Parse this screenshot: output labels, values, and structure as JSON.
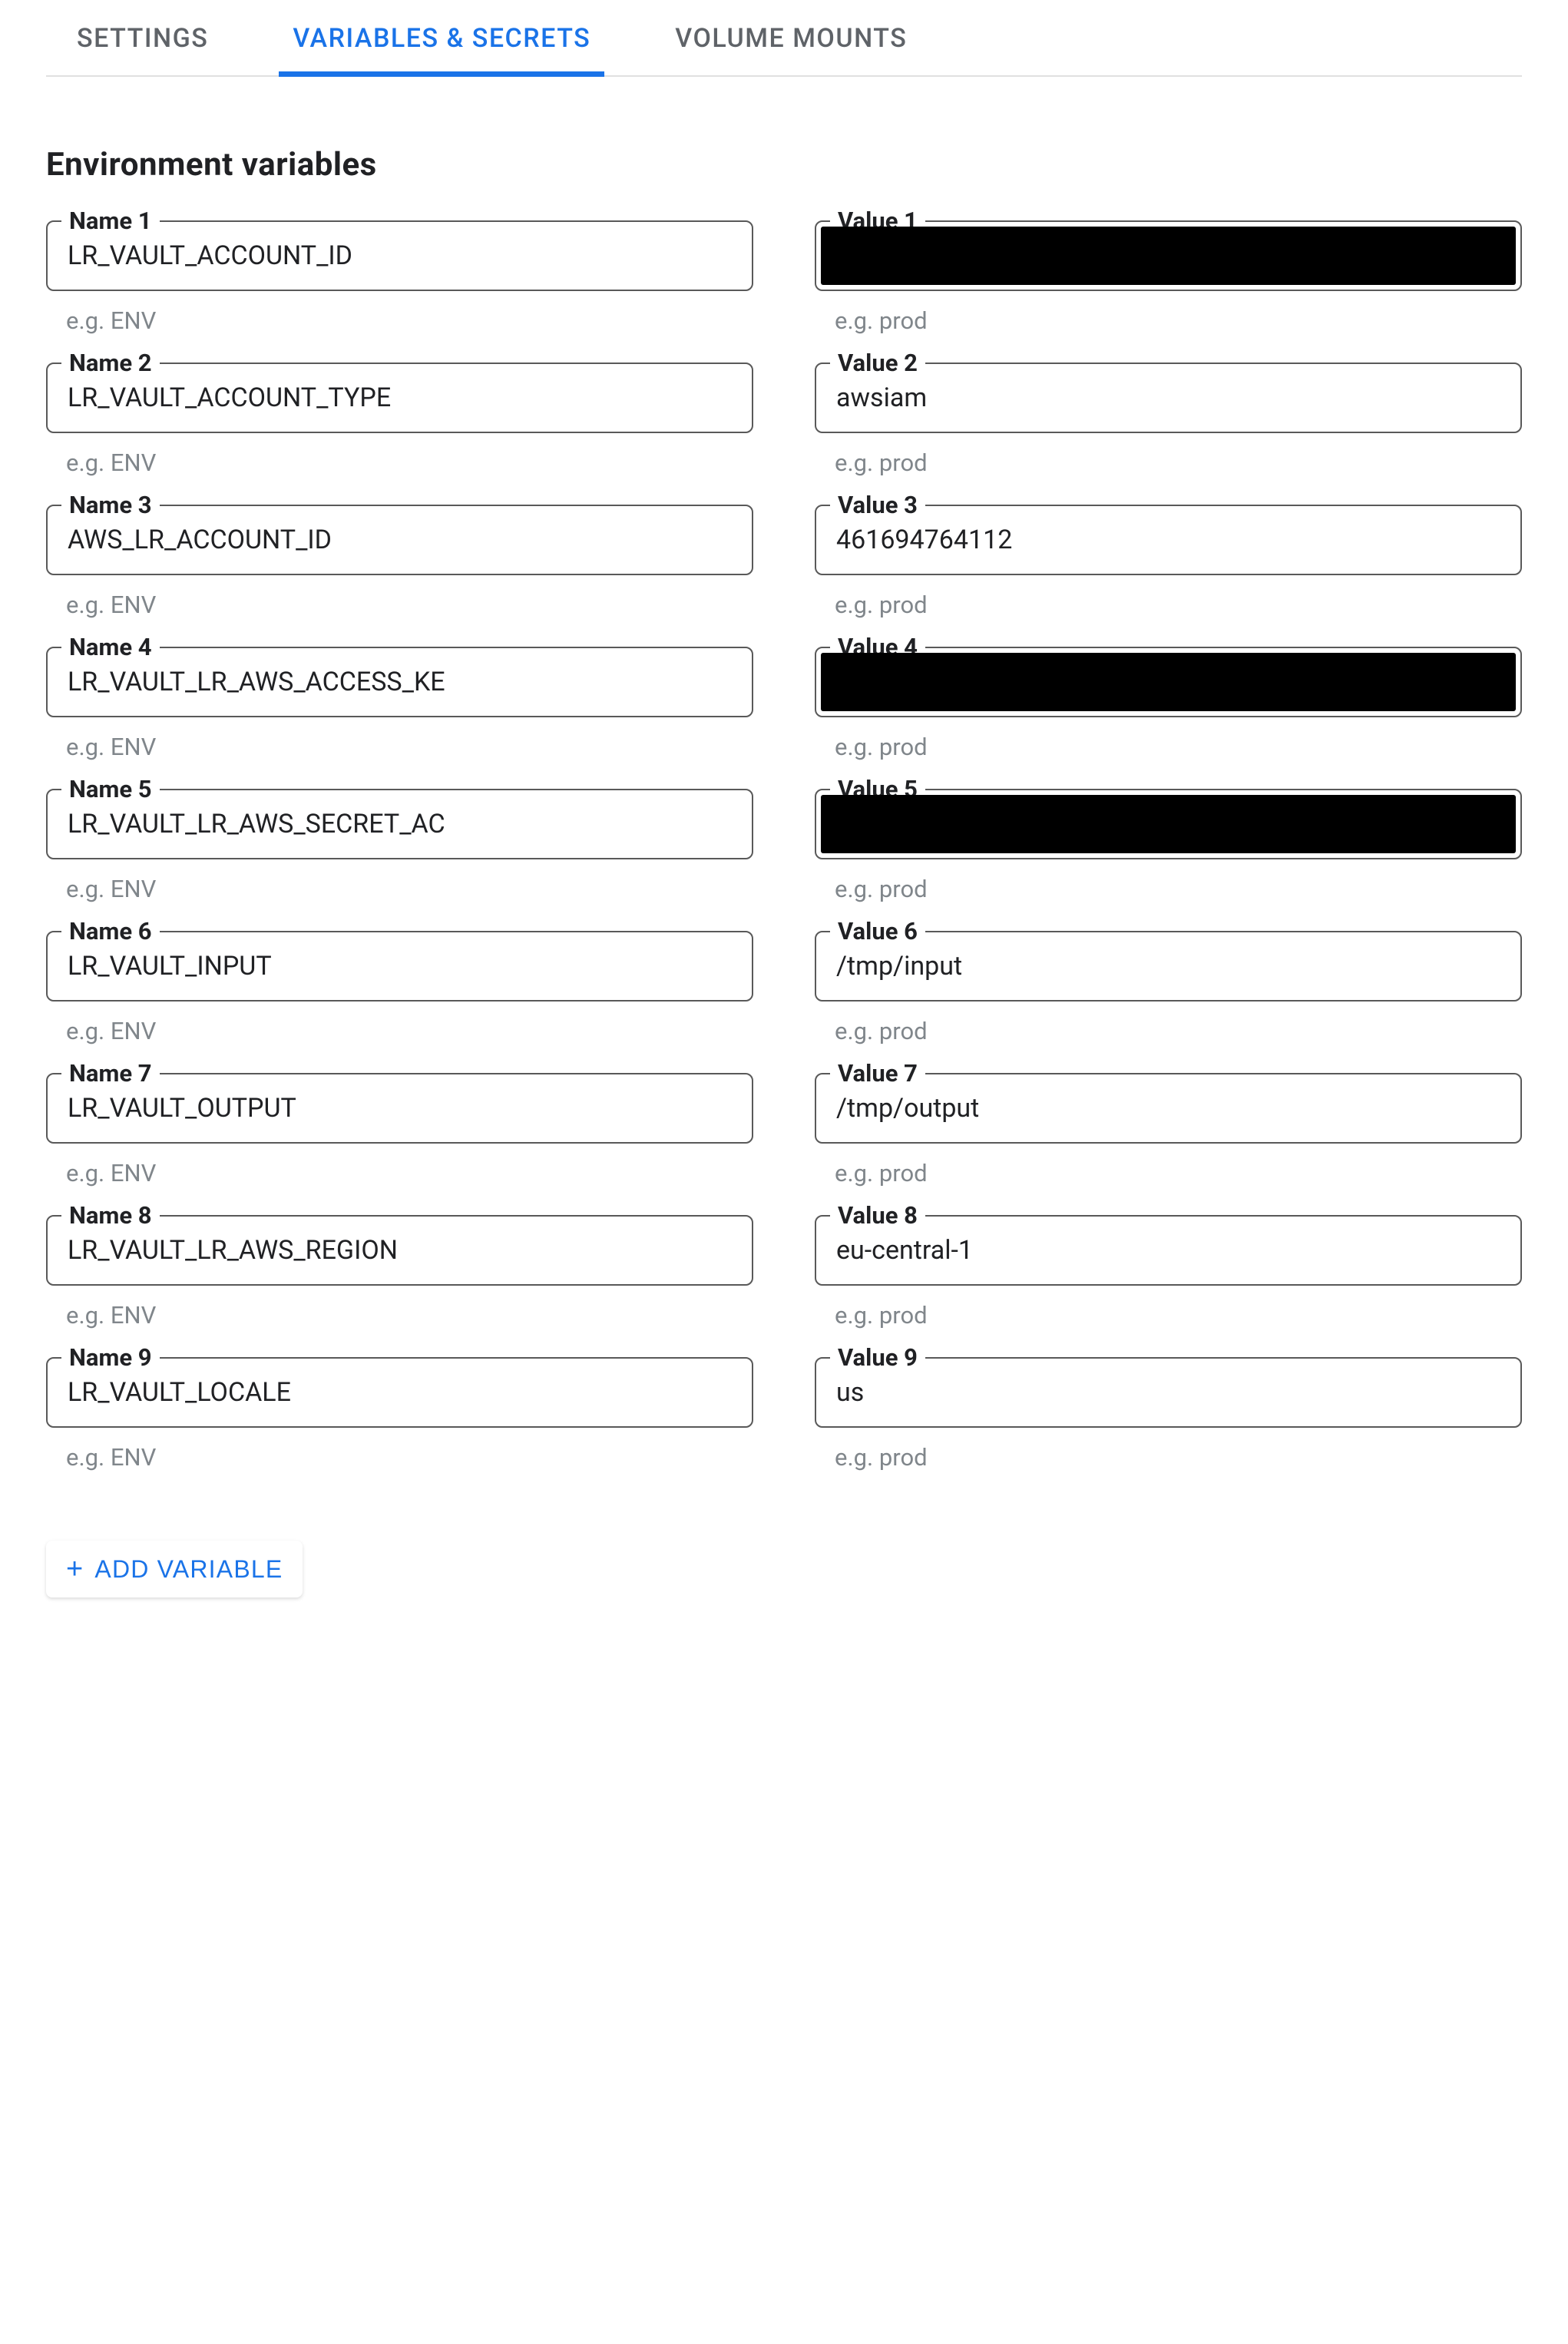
{
  "tabs": {
    "settings": "SETTINGS",
    "variables": "VARIABLES & SECRETS",
    "volumes": "VOLUME MOUNTS"
  },
  "section_title": "Environment variables",
  "hints": {
    "name": "e.g. ENV",
    "value": "e.g. prod"
  },
  "labels": {
    "name_prefix": "Name",
    "value_prefix": "Value"
  },
  "rows": [
    {
      "idx": "1",
      "name": "LR_VAULT_ACCOUNT_ID",
      "value": "",
      "redacted": true
    },
    {
      "idx": "2",
      "name": "LR_VAULT_ACCOUNT_TYPE",
      "value": "awsiam",
      "redacted": false
    },
    {
      "idx": "3",
      "name": "AWS_LR_ACCOUNT_ID",
      "value": "461694764112",
      "redacted": false
    },
    {
      "idx": "4",
      "name": "LR_VAULT_LR_AWS_ACCESS_KE",
      "value": "",
      "redacted": true
    },
    {
      "idx": "5",
      "name": "LR_VAULT_LR_AWS_SECRET_AC",
      "value": "",
      "redacted": true
    },
    {
      "idx": "6",
      "name": "LR_VAULT_INPUT",
      "value": "/tmp/input",
      "redacted": false
    },
    {
      "idx": "7",
      "name": "LR_VAULT_OUTPUT",
      "value": "/tmp/output",
      "redacted": false
    },
    {
      "idx": "8",
      "name": "LR_VAULT_LR_AWS_REGION",
      "value": "eu-central-1",
      "redacted": false
    },
    {
      "idx": "9",
      "name": "LR_VAULT_LOCALE",
      "value": "us",
      "redacted": false
    }
  ],
  "add_button": "ADD VARIABLE"
}
